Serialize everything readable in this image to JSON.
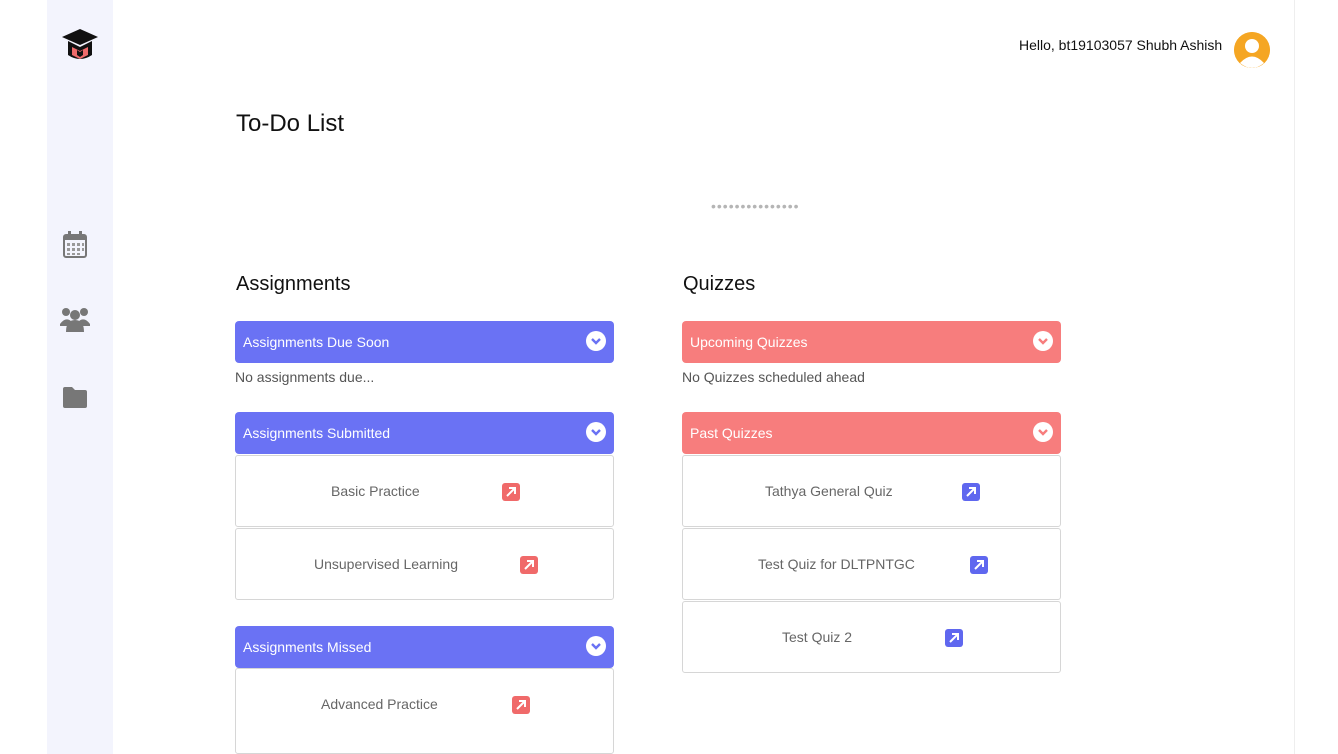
{
  "header": {
    "greeting": "Hello, bt19103057 Shubh Ashish"
  },
  "sidebar": {
    "icons": [
      "graduation-cap-logo",
      "calendar-icon",
      "users-icon",
      "folder-icon"
    ]
  },
  "page": {
    "title": "To-Do List",
    "loader": "•••••••••••••••"
  },
  "assignments": {
    "heading": "Assignments",
    "due_soon": {
      "label": "Assignments Due Soon",
      "empty": "No assignments due..."
    },
    "submitted": {
      "label": "Assignments Submitted",
      "items": [
        "Basic Practice",
        "Unsupervised Learning"
      ]
    },
    "missed": {
      "label": "Assignments Missed",
      "items": [
        "Advanced Practice"
      ]
    }
  },
  "quizzes": {
    "heading": "Quizzes",
    "upcoming": {
      "label": "Upcoming Quizzes",
      "empty": "No Quizzes scheduled ahead"
    },
    "past": {
      "label": "Past Quizzes",
      "items": [
        "Tathya General Quiz",
        "Test Quiz for DLTPNTGC",
        "Test Quiz 2"
      ]
    }
  },
  "colors": {
    "assignment_accent": "#6a72f4",
    "quiz_accent": "#f77d7d",
    "sidebar_bg": "#f3f4fd",
    "avatar": "#f5a623"
  }
}
